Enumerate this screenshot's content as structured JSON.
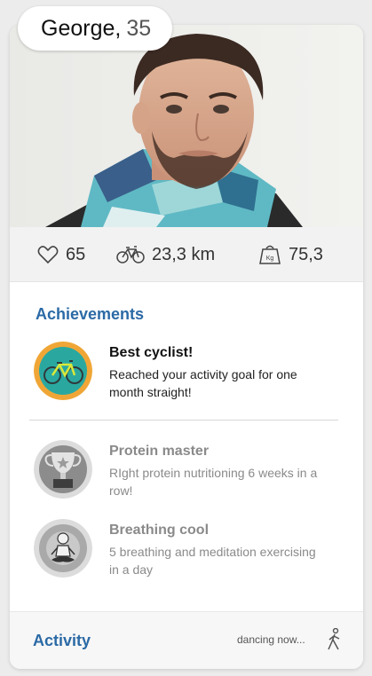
{
  "profile": {
    "name": "George",
    "separator": ",",
    "age": "35"
  },
  "stats": {
    "likes": "65",
    "distance": "23,3 km",
    "weight": "75,3",
    "weight_icon_label": "Kg"
  },
  "achievements": {
    "title": "Achievements",
    "items": [
      {
        "title": "Best cyclist!",
        "description": "Reached your activity goal for one month straight!",
        "icon": "bicycle-icon",
        "state": "earned"
      },
      {
        "title": "Protein master",
        "description": "RIght protein nutritioning 6 weeks in a row!",
        "icon": "trophy-icon",
        "state": "locked"
      },
      {
        "title": "Breathing cool",
        "description": "5 breathing and meditation exercising in a day",
        "icon": "meditation-icon",
        "state": "locked"
      }
    ]
  },
  "activity": {
    "title": "Activity",
    "status": "dancing now..."
  },
  "colors": {
    "accent": "#2b6aa6",
    "badge_earned_ring": "#f0a636",
    "badge_earned_fill": "#2aa8a0"
  }
}
